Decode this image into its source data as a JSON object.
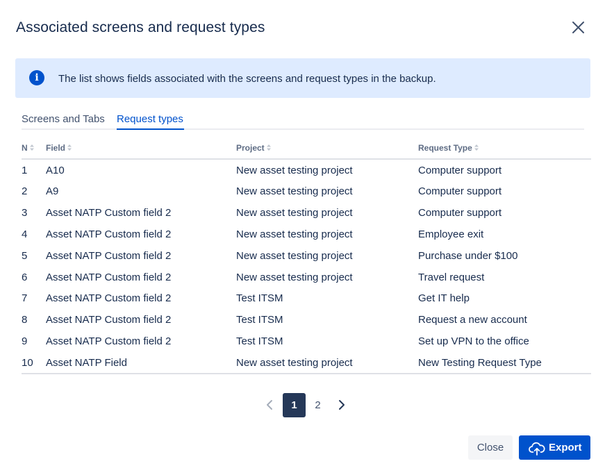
{
  "dialog": {
    "title": "Associated screens and request types",
    "close_icon": "close-icon"
  },
  "info": {
    "icon": "info-icon",
    "icon_glyph": "i",
    "text": "The list shows fields associated with the screens and request types in the backup."
  },
  "tabs": [
    {
      "label": "Screens and Tabs",
      "active": false
    },
    {
      "label": "Request types",
      "active": true
    }
  ],
  "table": {
    "headers": {
      "n": "N",
      "field": "Field",
      "project": "Project",
      "type": "Request Type"
    },
    "rows": [
      {
        "n": "1",
        "field": "A10",
        "project": "New asset testing project",
        "type": "Computer support"
      },
      {
        "n": "2",
        "field": "A9",
        "project": "New asset testing project",
        "type": "Computer support"
      },
      {
        "n": "3",
        "field": "Asset NATP Custom field 2",
        "project": "New asset testing project",
        "type": "Computer support"
      },
      {
        "n": "4",
        "field": "Asset NATP Custom field 2",
        "project": "New asset testing project",
        "type": "Employee exit"
      },
      {
        "n": "5",
        "field": "Asset NATP Custom field 2",
        "project": "New asset testing project",
        "type": "Purchase under $100"
      },
      {
        "n": "6",
        "field": "Asset NATP Custom field 2",
        "project": "New asset testing project",
        "type": "Travel request"
      },
      {
        "n": "7",
        "field": "Asset NATP Custom field 2",
        "project": "Test ITSM",
        "type": "Get IT help"
      },
      {
        "n": "8",
        "field": "Asset NATP Custom field 2",
        "project": "Test ITSM",
        "type": "Request a new account"
      },
      {
        "n": "9",
        "field": "Asset NATP Custom field 2",
        "project": "Test ITSM",
        "type": "Set up VPN to the office"
      },
      {
        "n": "10",
        "field": "Asset NATP Field",
        "project": "New asset testing project",
        "type": "New Testing Request Type"
      }
    ]
  },
  "pagination": {
    "pages": [
      "1",
      "2"
    ],
    "current": "1",
    "prev_icon": "chevron-left-icon",
    "next_icon": "chevron-right-icon"
  },
  "footer": {
    "close_label": "Close",
    "export_label": "Export",
    "export_icon": "cloud-upload-icon"
  },
  "colors": {
    "accent": "#0052CC",
    "banner_bg": "#DEEBFF",
    "current_page_bg": "#253858",
    "text": "#172B4D"
  }
}
